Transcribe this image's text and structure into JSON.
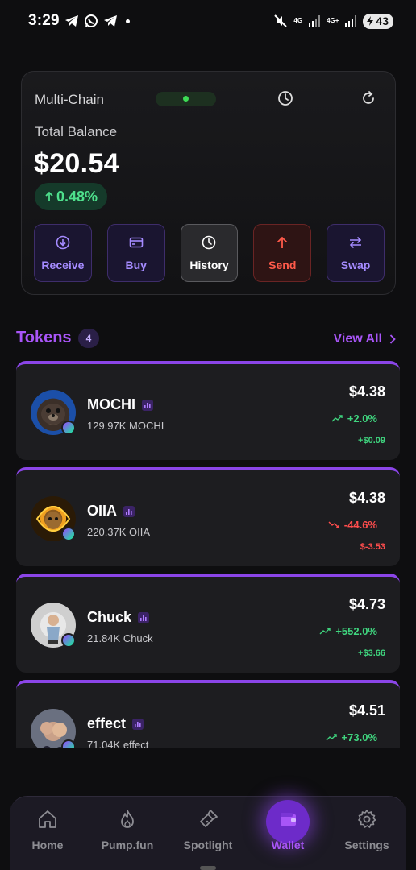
{
  "status_bar": {
    "time": "3:29",
    "network_1": "4G",
    "network_2": "4G+",
    "battery": "43",
    "icons": [
      "telegram-icon",
      "whatsapp-icon",
      "telegram-icon",
      "dot-icon",
      "mute-icon",
      "signal-icon",
      "signal-icon",
      "battery-icon"
    ]
  },
  "wallet": {
    "chain": "Multi-Chain",
    "total_label": "Total Balance",
    "total_value": "$20.54",
    "change": "0.48%",
    "actions": [
      {
        "label": "Receive",
        "icon": "arrow-down-circle-icon"
      },
      {
        "label": "Buy",
        "icon": "card-icon"
      },
      {
        "label": "History",
        "icon": "clock-icon"
      },
      {
        "label": "Send",
        "icon": "arrow-up-icon"
      },
      {
        "label": "Swap",
        "icon": "swap-icon"
      }
    ]
  },
  "tokens": {
    "title": "Tokens",
    "count": "4",
    "view_all": "View All",
    "items": [
      {
        "name": "MOCHI",
        "qty": "129.97K MOCHI",
        "value": "$4.38",
        "pct": "+2.0%",
        "abs": "+$0.09",
        "trend": "up"
      },
      {
        "name": "OIIA",
        "qty": "220.37K OIIA",
        "value": "$4.38",
        "pct": "-44.6%",
        "abs": "$-3.53",
        "trend": "down"
      },
      {
        "name": "Chuck",
        "qty": "21.84K Chuck",
        "value": "$4.73",
        "pct": "+552.0%",
        "abs": "+$3.66",
        "trend": "up"
      },
      {
        "name": "effect",
        "qty": "71.04K effect",
        "value": "$4.51",
        "pct": "+73.0%",
        "abs": "",
        "trend": "up"
      }
    ]
  },
  "nav": {
    "items": [
      {
        "label": "Home",
        "icon": "home-icon"
      },
      {
        "label": "Pump.fun",
        "icon": "flame-icon"
      },
      {
        "label": "Spotlight",
        "icon": "flashlight-icon"
      },
      {
        "label": "Wallet",
        "icon": "wallet-icon"
      },
      {
        "label": "Settings",
        "icon": "gear-icon"
      }
    ],
    "active": "Wallet"
  },
  "colors": {
    "accent": "#a855f7",
    "up": "#3fd47e",
    "down": "#ff4d4d"
  }
}
